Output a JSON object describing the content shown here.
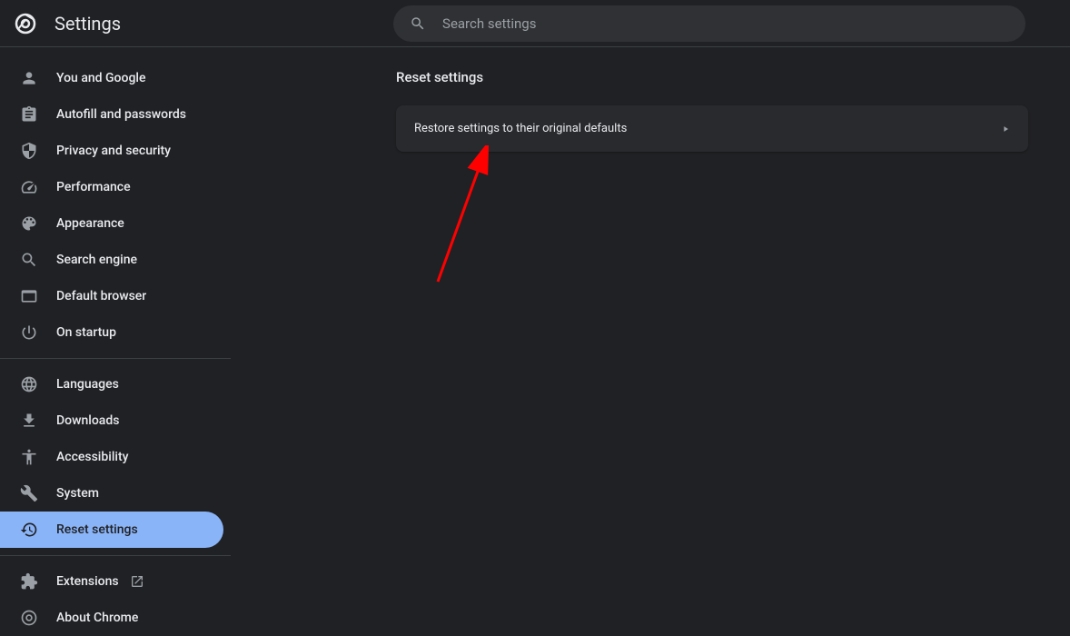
{
  "header": {
    "title": "Settings",
    "search_placeholder": "Search settings"
  },
  "sidebar": {
    "groups": [
      {
        "items": [
          {
            "id": "you-and-google",
            "label": "You and Google",
            "icon": "person"
          },
          {
            "id": "autofill",
            "label": "Autofill and passwords",
            "icon": "clipboard"
          },
          {
            "id": "privacy",
            "label": "Privacy and security",
            "icon": "shield"
          },
          {
            "id": "performance",
            "label": "Performance",
            "icon": "speedometer"
          },
          {
            "id": "appearance",
            "label": "Appearance",
            "icon": "palette"
          },
          {
            "id": "search-engine",
            "label": "Search engine",
            "icon": "search"
          },
          {
            "id": "default-browser",
            "label": "Default browser",
            "icon": "browser"
          },
          {
            "id": "on-startup",
            "label": "On startup",
            "icon": "power"
          }
        ]
      },
      {
        "items": [
          {
            "id": "languages",
            "label": "Languages",
            "icon": "globe"
          },
          {
            "id": "downloads",
            "label": "Downloads",
            "icon": "download"
          },
          {
            "id": "accessibility",
            "label": "Accessibility",
            "icon": "accessibility"
          },
          {
            "id": "system",
            "label": "System",
            "icon": "wrench"
          },
          {
            "id": "reset",
            "label": "Reset settings",
            "icon": "reset",
            "active": true
          }
        ]
      },
      {
        "items": [
          {
            "id": "extensions",
            "label": "Extensions",
            "icon": "puzzle",
            "external": true
          },
          {
            "id": "about",
            "label": "About Chrome",
            "icon": "chrome"
          }
        ]
      }
    ]
  },
  "main": {
    "section_title": "Reset settings",
    "restore_label": "Restore settings to their original defaults"
  }
}
